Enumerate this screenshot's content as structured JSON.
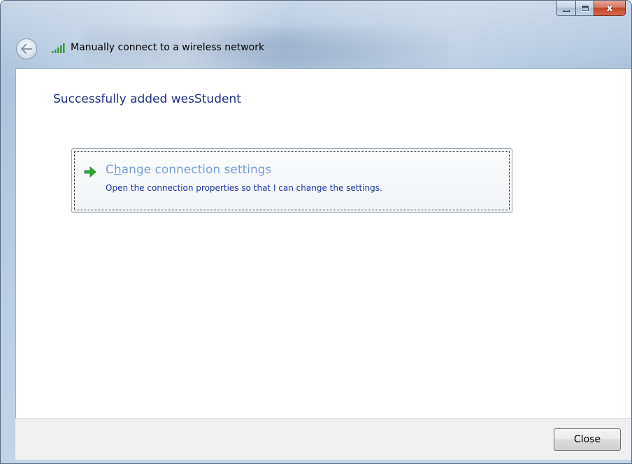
{
  "window": {
    "title_bar_buttons": {
      "minimize_icon": "minimize-icon",
      "maximize_icon": "maximize-icon",
      "close_label": "x"
    }
  },
  "header": {
    "back_icon": "back-arrow-icon",
    "network_icon": "wireless-signal-icon",
    "title": "Manually connect to a wireless network"
  },
  "main": {
    "heading": "Successfully added wesStudent",
    "command_link": {
      "icon": "green-arrow-icon",
      "title_prefix": "C",
      "title_accesskey": "h",
      "title_suffix": "ange connection settings",
      "description": "Open the connection properties so that I can change the settings."
    }
  },
  "footer": {
    "close_label": "Close"
  },
  "colors": {
    "heading": "#1e3287",
    "link_title": "#7a9fd8",
    "link_desc": "#1b34a8",
    "arrow_green": "#2eaa2e"
  }
}
